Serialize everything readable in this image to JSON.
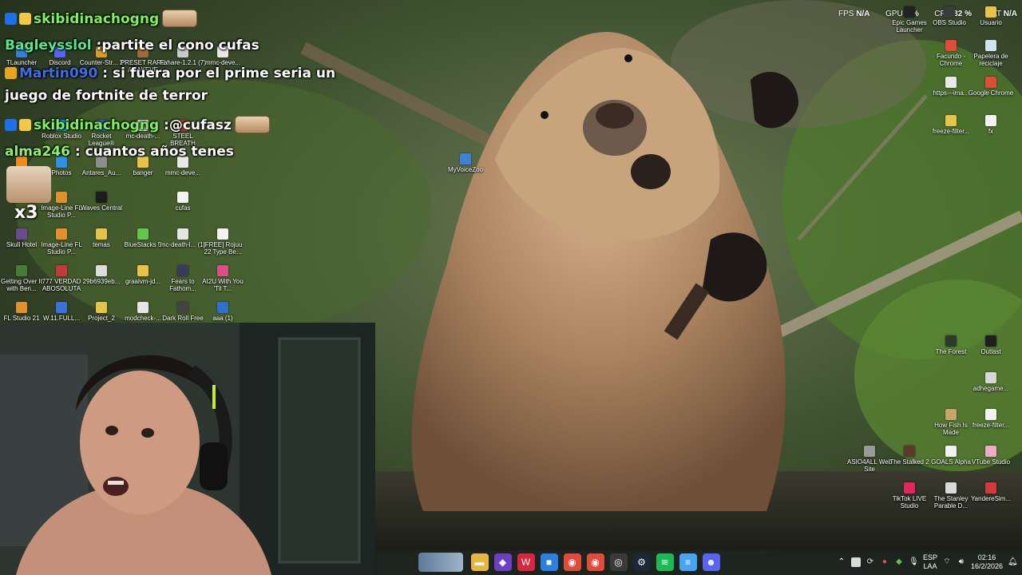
{
  "overlay_stats": {
    "fps_label": "FPS",
    "fps_value": "N/A",
    "gpu_label": "GPU",
    "gpu_value": "7 %",
    "cpu_label": "CPU",
    "cpu_value": "32 %",
    "lat_label": "LAT",
    "lat_value": "N/A"
  },
  "chat": [
    {
      "user": "skibidinachogng",
      "user_color": "#7cf35a",
      "text": "",
      "has_emote": true,
      "badges": [
        "#1f6fe8",
        "#f2c84b"
      ]
    },
    {
      "user": "Bagleysslol",
      "user_color": "#55e88a",
      "text": " :partite el cono cufas",
      "has_emote": false,
      "badges": []
    },
    {
      "user": "Martin090",
      "user_color": "#3f6de8",
      "text": " : si fuera por el prime seria un",
      "has_emote": false,
      "badges": [
        "#e8a520"
      ]
    },
    {
      "user": "",
      "user_color": "#ffffff",
      "text": "juego de fortnite de terror",
      "has_emote": false,
      "badges": []
    },
    {
      "user": "skibidinachogng",
      "user_color": "#7cf35a",
      "text": " :@cufasz",
      "has_emote": true,
      "badges": [
        "#1f6fe8",
        "#f2c84b"
      ]
    },
    {
      "user": "alma246",
      "user_color": "#8ef06c",
      "text": " : cuantos años tenes",
      "has_emote": false,
      "badges": []
    }
  ],
  "chat_badge_text": "x3",
  "desktop_icons": [
    {
      "label": "TLauncher",
      "color": "#3a7bd5"
    },
    {
      "label": "Discord",
      "color": "#5865f2"
    },
    {
      "label": "Counter-Str... 2",
      "color": "#d99b2b"
    },
    {
      "label": "PRESET RARE ANAKEVE",
      "color": "#9c6a3c"
    },
    {
      "label": "Fahare-1.2.1 (7)",
      "color": "#c9c9c9"
    },
    {
      "label": "mmc-deve...",
      "color": "#e8e8e8"
    },
    {
      "label": "Roblox Studio",
      "color": "#1a8cff"
    },
    {
      "label": "Rocket League®",
      "color": "#2a5fb0"
    },
    {
      "label": "mc-death-...",
      "color": "#e5e5e5"
    },
    {
      "label": "STEEL BREATH",
      "color": "#b23a2f"
    },
    {
      "label": "VLC",
      "color": "#f08a1c"
    },
    {
      "label": "Photos",
      "color": "#2f8fe0"
    },
    {
      "label": "Antares_Au...",
      "color": "#8d8d8d"
    },
    {
      "label": "banger",
      "color": "#e8c34a"
    },
    {
      "label": "mmc-deve...",
      "color": "#e8e8e8"
    },
    {
      "label": "Image-Line FL Studio P...",
      "color": "#e2902b"
    },
    {
      "label": "Waves Central",
      "color": "#1c1c1c"
    },
    {
      "label": "cufas",
      "color": "#f2f2f2"
    },
    {
      "label": "Skull Hotel",
      "color": "#6b4a8e"
    },
    {
      "label": "Image-Line FL Studio P...",
      "color": "#e2902b"
    },
    {
      "label": "temas",
      "color": "#e8c34a"
    },
    {
      "label": "BlueStacks 5",
      "color": "#63c54b"
    },
    {
      "label": "mc-death-l... (1)",
      "color": "#e5e5e5"
    },
    {
      "label": "[FREE] Rojuu 22 Type Be...",
      "color": "#f2f2f2"
    },
    {
      "label": "Getting Over It with Ben...",
      "color": "#4a7a3a"
    },
    {
      "label": "777 VERDAD ABOSOLUTA",
      "color": "#c23b3b"
    },
    {
      "label": "29b6939eb...",
      "color": "#dcdcdc"
    },
    {
      "label": "graalvm-jd...",
      "color": "#e8c34a"
    },
    {
      "label": "Fears to Fathom...",
      "color": "#3a3a5a"
    },
    {
      "label": "AI2U With You 'Til T...",
      "color": "#d94f86"
    },
    {
      "label": "FL Studio 21",
      "color": "#e2902b"
    },
    {
      "label": "W.11.FULL...",
      "color": "#3b72d9"
    },
    {
      "label": "Project_2",
      "color": "#e8c34a"
    },
    {
      "label": "modcheck-...",
      "color": "#e5e5e5"
    },
    {
      "label": "Dark Roll Free",
      "color": "#444444"
    },
    {
      "label": "aaa (1)",
      "color": "#2f6fd0"
    },
    {
      "label": "MyVoiceZoo",
      "color": "#3f7fd8"
    },
    {
      "label": "Epic Games Launcher",
      "color": "#222222"
    },
    {
      "label": "OBS Studio",
      "color": "#3b3b3b"
    },
    {
      "label": "Usuario",
      "color": "#e8c34a"
    },
    {
      "label": "Facundo - Chrome",
      "color": "#e04b3a"
    },
    {
      "label": "Papelera de reciclaje",
      "color": "#cfe3f2"
    },
    {
      "label": "https---ima...",
      "color": "#e8e8e8"
    },
    {
      "label": "Google Chrome",
      "color": "#e04b3a"
    },
    {
      "label": "freeze-filter...",
      "color": "#e8c34a"
    },
    {
      "label": "fx",
      "color": "#f2f2f2"
    },
    {
      "label": "The Forest",
      "color": "#2c3a2c"
    },
    {
      "label": "Outlast",
      "color": "#1e1e1e"
    },
    {
      "label": "adhegame...",
      "color": "#d6d6d6"
    },
    {
      "label": "How Fish Is Made",
      "color": "#c9a46a"
    },
    {
      "label": "freeze-filter...",
      "color": "#f2f2f2"
    },
    {
      "label": "ASIO4ALL Web Site",
      "color": "#9a9a9a"
    },
    {
      "label": "The Stalked 2",
      "color": "#5a3a2a"
    },
    {
      "label": "GOALS Alpha",
      "color": "#f2f2f2"
    },
    {
      "label": "VTube Studio",
      "color": "#f0a9c9"
    },
    {
      "label": "TikTok LIVE Studio",
      "color": "#e3265f"
    },
    {
      "label": "The Stanley Parable D...",
      "color": "#d9d9d9"
    },
    {
      "label": "YandereSim...",
      "color": "#d23a3a"
    }
  ],
  "taskbar": {
    "apps": [
      {
        "icon": "file-explorer-icon",
        "color": "#e8b63c",
        "glyph": "▬"
      },
      {
        "icon": "visual-studio-icon",
        "color": "#6d3fc4",
        "glyph": "◆"
      },
      {
        "icon": "wps-office-icon",
        "color": "#d7263d",
        "glyph": "W"
      },
      {
        "icon": "microsoft-store-icon",
        "color": "#2b7fe0",
        "glyph": "■"
      },
      {
        "icon": "chrome-icon",
        "color": "#e04b3a",
        "glyph": "◉"
      },
      {
        "icon": "chrome-profile-icon",
        "color": "#e04b3a",
        "glyph": "◉"
      },
      {
        "icon": "obs-icon",
        "color": "#3a3a3a",
        "glyph": "◎"
      },
      {
        "icon": "steam-icon",
        "color": "#1b2838",
        "glyph": "⚙"
      },
      {
        "icon": "spotify-icon",
        "color": "#1db954",
        "glyph": "≋"
      },
      {
        "icon": "notepad-icon",
        "color": "#4aa3f0",
        "glyph": "≡"
      },
      {
        "icon": "discord-icon",
        "color": "#5865f2",
        "glyph": "☻"
      }
    ],
    "language": "ESP",
    "language_sub": "LAA",
    "time": "02:16",
    "date": "16/2/2026"
  }
}
